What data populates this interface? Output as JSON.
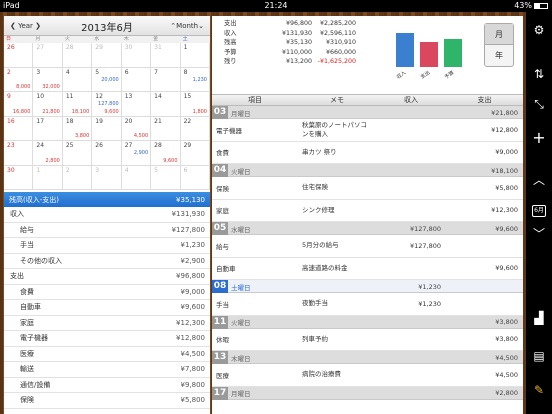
{
  "status": {
    "carrier": "iPad",
    "time": "21:24",
    "battery": "43%"
  },
  "calendar": {
    "year_label": "Year",
    "title": "2013年6月",
    "month_label": "Month",
    "dow": [
      "日",
      "月",
      "火",
      "水",
      "木",
      "金",
      "土"
    ],
    "cells": [
      {
        "d": "26",
        "other": true
      },
      {
        "d": "27",
        "other": true
      },
      {
        "d": "28",
        "other": true
      },
      {
        "d": "29",
        "other": true
      },
      {
        "d": "30",
        "other": true
      },
      {
        "d": "31",
        "other": true
      },
      {
        "d": "1"
      },
      {
        "d": "2",
        "exp": "8,000"
      },
      {
        "d": "3",
        "exp": "32,000"
      },
      {
        "d": "4"
      },
      {
        "d": "5",
        "inc": "20,000"
      },
      {
        "d": "6"
      },
      {
        "d": "7"
      },
      {
        "d": "8",
        "inc": "1,230"
      },
      {
        "d": "9",
        "exp": "16,800"
      },
      {
        "d": "10",
        "exp": "21,800"
      },
      {
        "d": "11",
        "exp": "18,100"
      },
      {
        "d": "12",
        "inc": "127,800",
        "exp": "9,600"
      },
      {
        "d": "13"
      },
      {
        "d": "14"
      },
      {
        "d": "15",
        "exp": "1,800"
      },
      {
        "d": "16"
      },
      {
        "d": "17"
      },
      {
        "d": "18",
        "exp": "3,800"
      },
      {
        "d": "19"
      },
      {
        "d": "20",
        "exp": "4,500"
      },
      {
        "d": "21"
      },
      {
        "d": "22"
      },
      {
        "d": "23"
      },
      {
        "d": "24",
        "exp": "2,800"
      },
      {
        "d": "25"
      },
      {
        "d": "26"
      },
      {
        "d": "27",
        "inc": "2,900"
      },
      {
        "d": "28",
        "exp": "9,600"
      },
      {
        "d": "29"
      },
      {
        "d": "30"
      },
      {
        "d": "1",
        "other": true
      },
      {
        "d": "2",
        "other": true
      },
      {
        "d": "3",
        "other": true
      },
      {
        "d": "4",
        "other": true
      },
      {
        "d": "5",
        "other": true
      },
      {
        "d": "6",
        "other": true
      }
    ]
  },
  "summary": {
    "head_label": "残高(収入-支出)",
    "head_value": "¥35,130",
    "rows": [
      {
        "label": "収入",
        "value": "¥131,930",
        "sub": false
      },
      {
        "label": "給与",
        "value": "¥127,800",
        "sub": true
      },
      {
        "label": "手当",
        "value": "¥1,230",
        "sub": true
      },
      {
        "label": "その他の収入",
        "value": "¥2,900",
        "sub": true
      },
      {
        "label": "支出",
        "value": "¥96,800",
        "sub": false
      },
      {
        "label": "食費",
        "value": "¥9,000",
        "sub": true
      },
      {
        "label": "自動車",
        "value": "¥9,600",
        "sub": true
      },
      {
        "label": "家庭",
        "value": "¥12,300",
        "sub": true
      },
      {
        "label": "電子機器",
        "value": "¥12,800",
        "sub": true
      },
      {
        "label": "医療",
        "value": "¥4,500",
        "sub": true
      },
      {
        "label": "輸送",
        "value": "¥7,800",
        "sub": true
      },
      {
        "label": "通信/設備",
        "value": "¥9,800",
        "sub": true
      },
      {
        "label": "保険",
        "value": "¥5,800",
        "sub": true
      }
    ]
  },
  "stats": [
    {
      "label": "支出",
      "a": "¥96,800",
      "b": "¥2,285,200"
    },
    {
      "label": "収入",
      "a": "¥131,930",
      "b": "¥2,596,110"
    },
    {
      "label": "残高",
      "a": "¥35,130",
      "b": "¥310,910"
    },
    {
      "label": "予算",
      "a": "¥110,000",
      "b": "¥660,000"
    },
    {
      "label": "残り",
      "a": "¥13,200",
      "b": "-¥1,625,200"
    }
  ],
  "minichart": {
    "bars": [
      {
        "label": "収入",
        "value": 131930,
        "color": "#3a7fd0"
      },
      {
        "label": "支出",
        "value": 96800,
        "color": "#d9485f"
      },
      {
        "label": "予算",
        "value": 110000,
        "color": "#2fb56a"
      }
    ]
  },
  "toggle": {
    "month": "月",
    "year": "年"
  },
  "table": {
    "headers": [
      "項目",
      "メモ",
      "収入",
      "支出"
    ],
    "groups": [
      {
        "day": "03",
        "weekday": "月曜日",
        "amount": "¥21,800",
        "selected": false,
        "rows": [
          {
            "item": "電子機器",
            "memo": "秋葉原のノートパソコンを購入",
            "income": "",
            "expense": "¥12,800"
          },
          {
            "item": "食費",
            "memo": "串カツ 祭り",
            "income": "",
            "expense": "¥9,000"
          }
        ]
      },
      {
        "day": "04",
        "weekday": "火曜日",
        "amount": "¥18,100",
        "selected": false,
        "rows": [
          {
            "item": "保険",
            "memo": "住宅保険",
            "income": "",
            "expense": "¥5,800"
          },
          {
            "item": "家庭",
            "memo": "シンク修理",
            "income": "",
            "expense": "¥12,300"
          }
        ]
      },
      {
        "day": "05",
        "weekday": "水曜日",
        "amount": "¥9,600",
        "amount_income": "¥127,800",
        "selected": false,
        "rows": [
          {
            "item": "給与",
            "memo": "5月分の給与",
            "income": "¥127,800",
            "expense": ""
          },
          {
            "item": "自動車",
            "memo": "高速道路の料金",
            "income": "",
            "expense": "¥9,600"
          }
        ]
      },
      {
        "day": "08",
        "weekday": "土曜日",
        "amount": "",
        "amount_income": "¥1,230",
        "selected": true,
        "rows": [
          {
            "item": "手当",
            "memo": "夜勤手当",
            "income": "¥1,230",
            "expense": ""
          }
        ]
      },
      {
        "day": "11",
        "weekday": "火曜日",
        "amount": "¥3,800",
        "selected": false,
        "rows": [
          {
            "item": "休暇",
            "memo": "列車予約",
            "income": "",
            "expense": "¥3,800"
          }
        ]
      },
      {
        "day": "13",
        "weekday": "木曜日",
        "amount": "¥4,500",
        "selected": false,
        "rows": [
          {
            "item": "医療",
            "memo": "病院の治療費",
            "income": "",
            "expense": "¥4,500"
          }
        ]
      },
      {
        "day": "17",
        "weekday": "月曜日",
        "amount": "¥2,800",
        "selected": false,
        "rows": []
      }
    ]
  },
  "toolbar": {
    "icons": [
      "gear-icon",
      "sort-icon",
      "collapse-icon",
      "add-icon",
      "chevron-up-icon",
      "calendar-icon",
      "chevron-down-icon",
      "chart-icon",
      "document-icon",
      "pencil-icon"
    ],
    "calendar_label": "6月"
  }
}
